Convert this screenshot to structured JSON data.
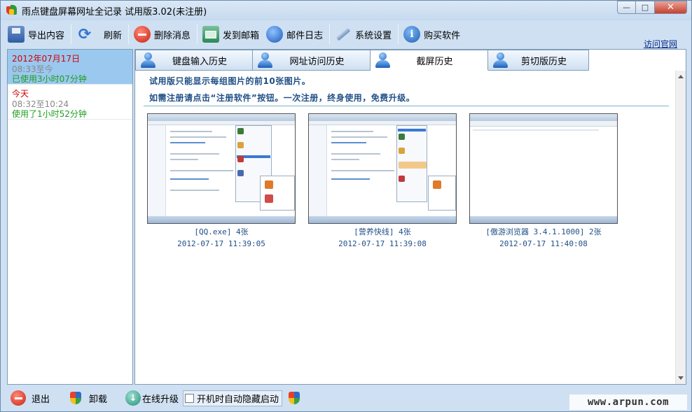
{
  "window": {
    "title": "雨点键盘屏幕网址全记录 试用版3.02(未注册)",
    "controls": {
      "minimize": "—",
      "maximize": "□",
      "close": "✕"
    }
  },
  "toolbar": {
    "items": [
      {
        "label": "导出内容",
        "icon": "export-icon"
      },
      {
        "label": "刷新",
        "icon": "refresh-icon"
      },
      {
        "label": "删除消息",
        "icon": "delete-icon"
      },
      {
        "label": "发到邮箱",
        "icon": "mail-icon"
      },
      {
        "label": "邮件日志",
        "icon": "globe-icon"
      },
      {
        "label": "系统设置",
        "icon": "settings-icon"
      },
      {
        "label": "购买软件",
        "icon": "info-icon"
      }
    ],
    "visit_site": "访问官网"
  },
  "sessions": [
    {
      "date": "2012年07月17日",
      "range": "08:33至今",
      "used": "已使用3小时07分钟",
      "selected": true
    },
    {
      "date": "今天",
      "range": "08:32至10:24",
      "used": "使用了1小时52分钟",
      "selected": false
    }
  ],
  "tabs": [
    {
      "label": "键盘输入历史",
      "active": false
    },
    {
      "label": "网址访问历史",
      "active": false
    },
    {
      "label": "截屏历史",
      "active": true
    },
    {
      "label": "剪切版历史",
      "active": false
    }
  ],
  "notices": {
    "line1": "试用版只能显示每组图片的前10张图片。",
    "line2": "如需注册请点击“注册软件”按钮。一次注册，终身使用，免费升级。"
  },
  "screenshots": [
    {
      "caption": "[QQ.exe] 4张",
      "time": "2012-07-17 11:39:05"
    },
    {
      "caption": "[营养快线] 4张",
      "time": "2012-07-17 11:39:08"
    },
    {
      "caption": "[傲游浏览器 3.4.1.1000] 2张",
      "time": "2012-07-17 11:40:08"
    }
  ],
  "bottom": {
    "exit": "退出",
    "uninstall": "卸载",
    "upgrade": "在线升级",
    "autostart_label": "开机时自动隐藏启动",
    "autostart_checked": false
  },
  "watermark": "www.arpun.com",
  "colors": {
    "frame_bg": "#cfe0f2",
    "selected_session": "#9ac8ef",
    "date_red": "#d40000",
    "used_green": "#1f9e1f",
    "notice_blue": "#1f4f86"
  }
}
